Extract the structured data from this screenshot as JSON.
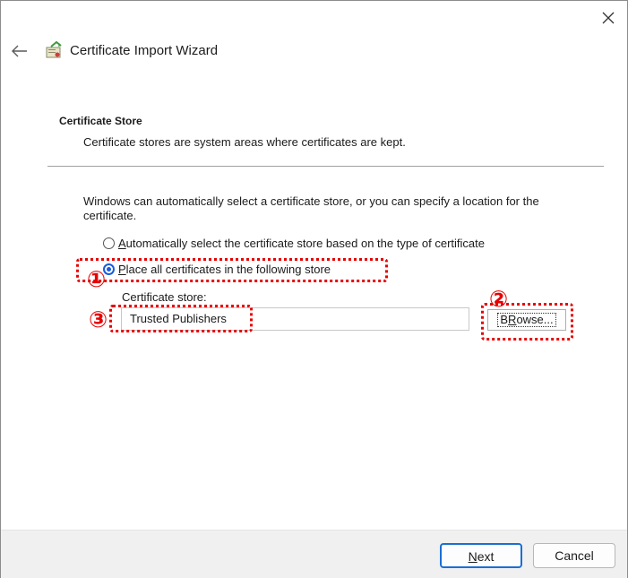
{
  "window": {
    "title": "Certificate Import Wizard",
    "icons": {
      "close": "close-icon",
      "back": "back-arrow-icon",
      "app": "certificate-wizard-icon"
    }
  },
  "section": {
    "heading": "Certificate Store",
    "description": "Certificate stores are system areas where certificates are kept."
  },
  "intro_text": "Windows can automatically select a certificate store, or you can specify a location for the certificate.",
  "options": {
    "auto": {
      "accel": "A",
      "rest": "utomatically select the certificate store based on the type of certificate",
      "checked": false
    },
    "place": {
      "accel": "P",
      "rest": "lace all certificates in the following store",
      "checked": true
    }
  },
  "store": {
    "label": "Certificate store:",
    "value": "Trusted Publishers",
    "browse_accel": "R",
    "browse_pre": "B",
    "browse_post": "owse..."
  },
  "annotations": {
    "one": "①",
    "two": "②",
    "three": "③",
    "color": "#e60000"
  },
  "footer": {
    "next_accel": "N",
    "next_rest": "ext",
    "cancel": "Cancel"
  },
  "colors": {
    "accent": "#1a6fd4",
    "footer_bg": "#f0f0f0"
  }
}
